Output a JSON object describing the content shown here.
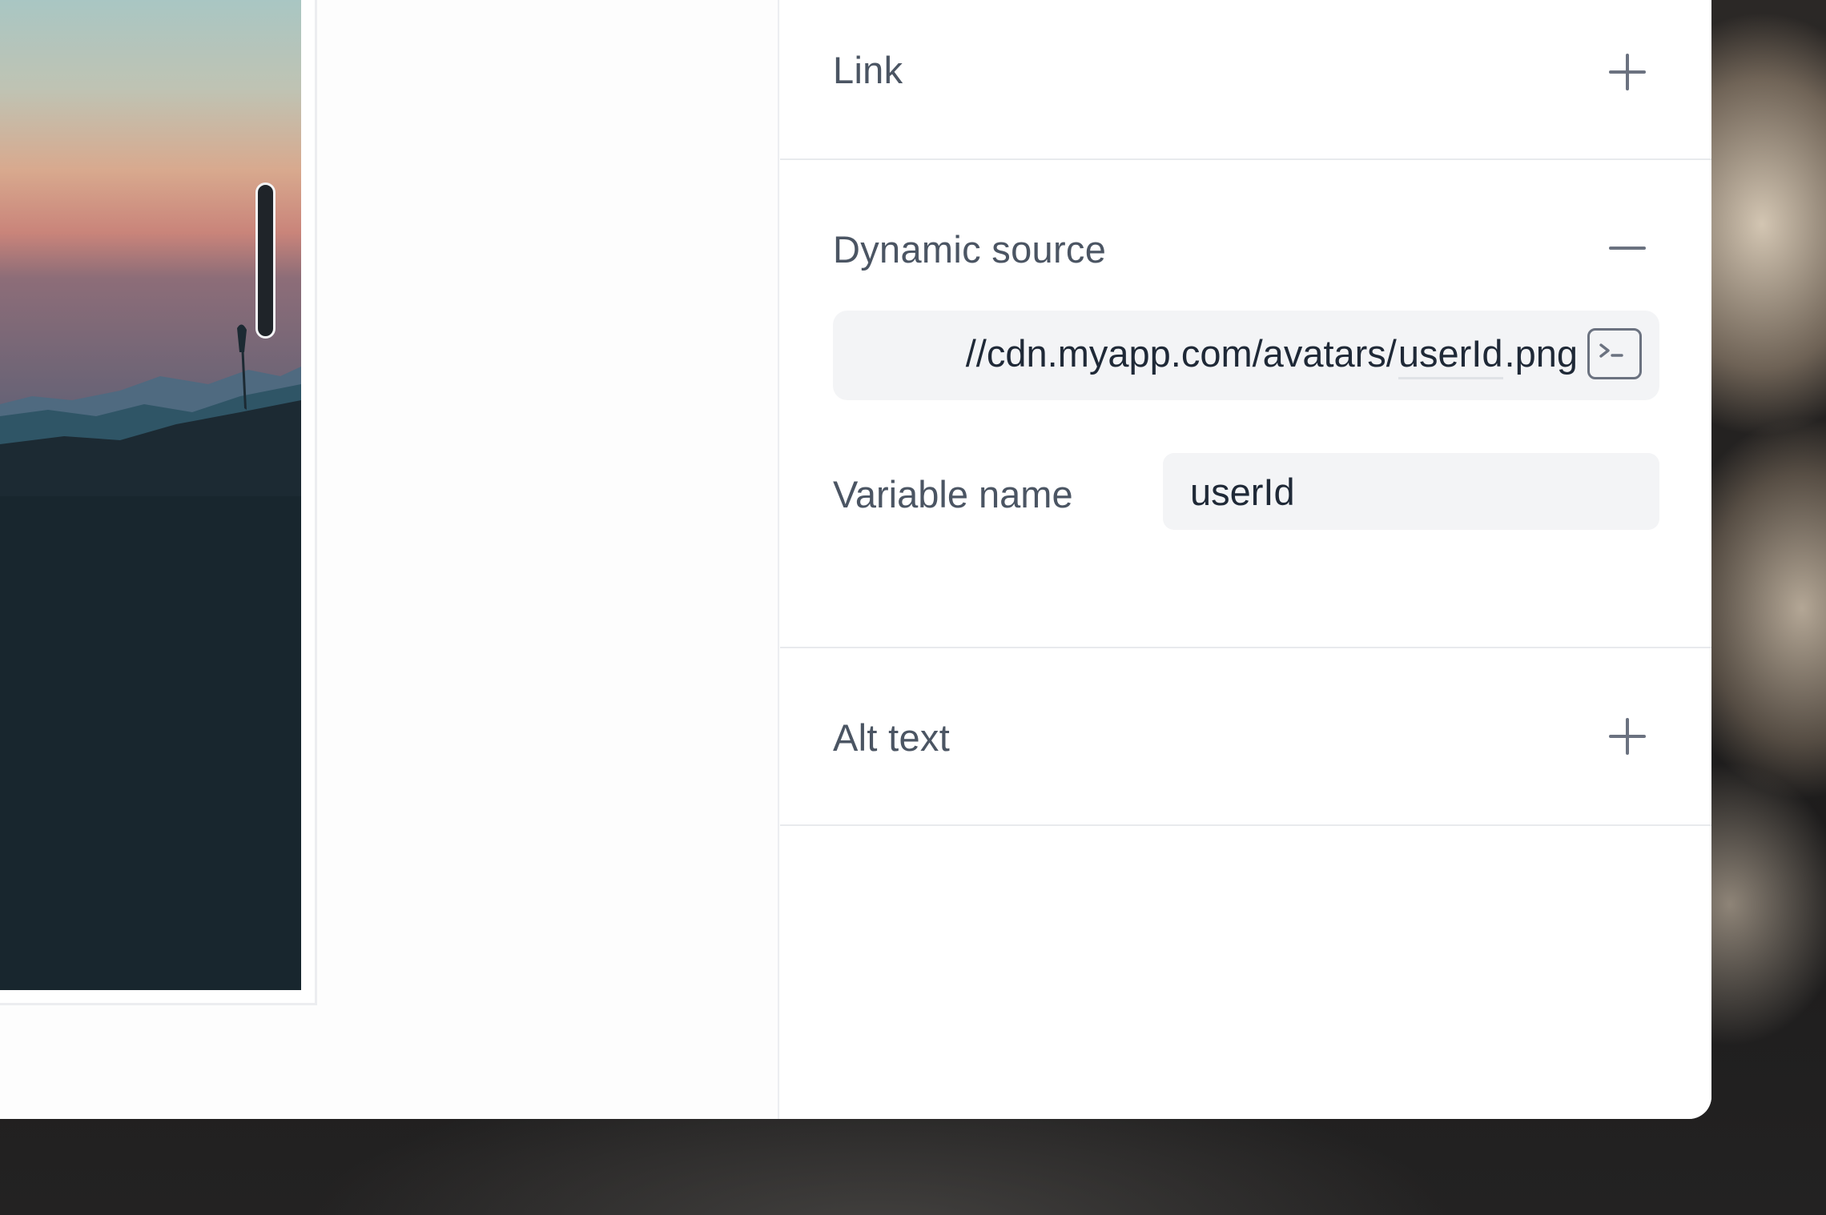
{
  "panel": {
    "link_section": {
      "title": "Link",
      "toggle": "expand"
    },
    "dynamic_section": {
      "title": "Dynamic source",
      "toggle": "collapse",
      "url_prefix": "//cdn.myapp.com/avatars/",
      "url_variable": "userId",
      "url_suffix": ".png",
      "variable_name_label": "Variable name",
      "variable_name_value": "userId",
      "code_button_icon": "terminal-icon"
    },
    "alt_section": {
      "title": "Alt text",
      "toggle": "expand"
    }
  },
  "colors": {
    "label": "#4b5563",
    "field_bg": "#f3f4f6",
    "divider": "#e8eaed",
    "icon": "#6b7280"
  }
}
